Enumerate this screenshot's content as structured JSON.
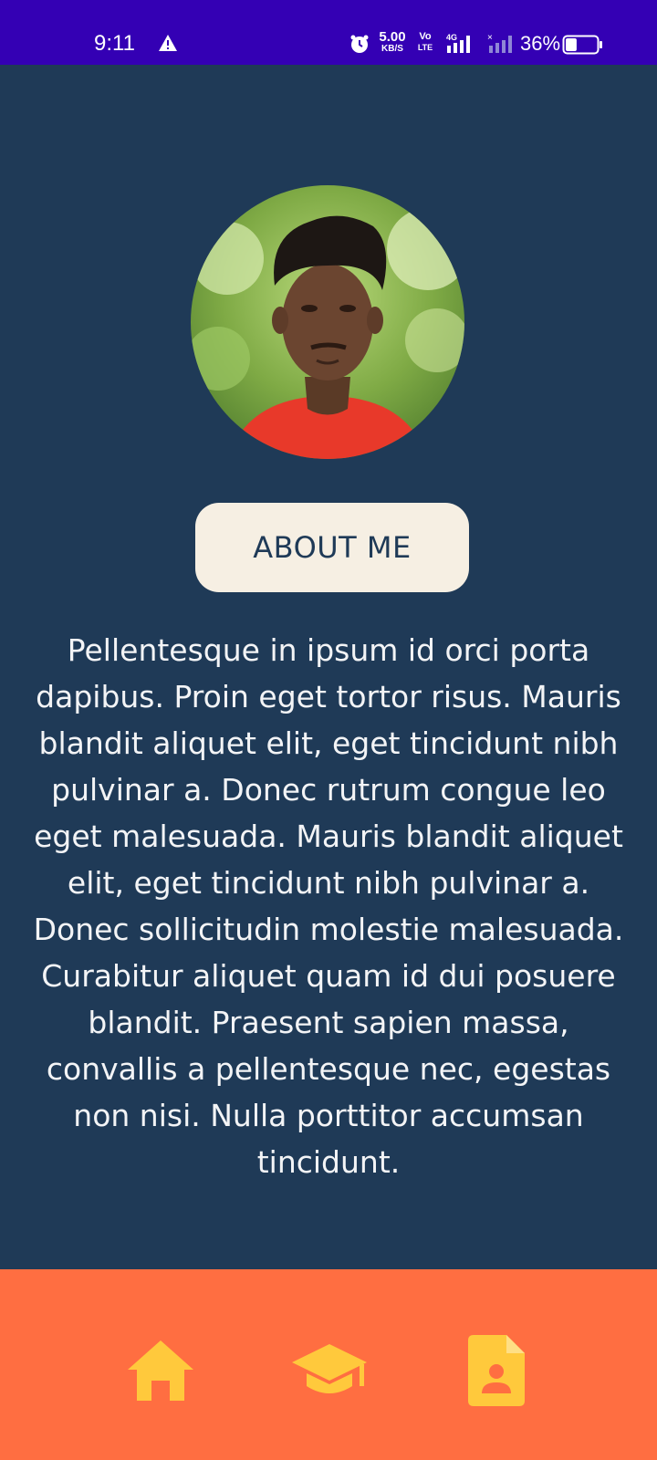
{
  "status_bar": {
    "time": "9:11",
    "net_speed_value": "5.00",
    "net_speed_unit": "KB/S",
    "volte_top": "Vo",
    "volte_bottom": "LTE",
    "network_type": "4G",
    "battery_percent": "36%",
    "battery_level": 0.36,
    "background_color": "#3400b4"
  },
  "profile": {
    "avatar_alt": "Profile photo"
  },
  "about_button": {
    "label": "ABOUT ME"
  },
  "bio": {
    "text": "Pellentesque in ipsum id orci porta dapibus. Proin eget tortor risus. Mauris blandit aliquet elit, eget tincidunt nibh pulvinar a. Donec rutrum congue leo eget malesuada. Mauris blandit aliquet elit, eget tincidunt nibh pulvinar a. Donec sollicitudin molestie malesuada. Curabitur aliquet quam id dui posuere blandit. Praesent sapien massa, convallis a pellentesque nec, egestas non nisi. Nulla porttitor accumsan tincidunt."
  },
  "bottom_nav": {
    "items": [
      {
        "icon": "home-icon"
      },
      {
        "icon": "graduation-cap-icon"
      },
      {
        "icon": "resume-icon"
      }
    ],
    "background_color": "#ff6e41",
    "icon_color": "#ffc93c"
  },
  "theme": {
    "page_background": "#1f3a57",
    "button_background": "#f6efe3",
    "text_color": "#f3f4f6"
  }
}
